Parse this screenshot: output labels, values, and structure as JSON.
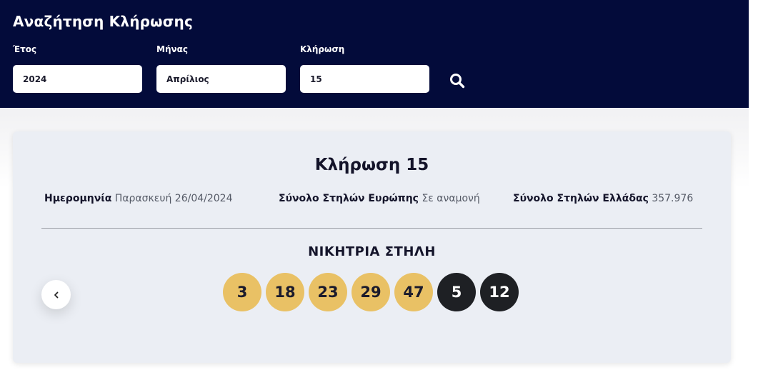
{
  "search": {
    "title": "Αναζήτηση Κλήρωσης",
    "year_label": "Έτος",
    "year_value": "2024",
    "month_label": "Μήνας",
    "month_value": "Απρίλιος",
    "draw_label": "Κλήρωση",
    "draw_value": "15",
    "search_icon": "search-icon"
  },
  "result": {
    "title": "Κλήρωση 15",
    "date_label": "Ημερομηνία",
    "date_value": "Παρασκευή 26/04/2024",
    "europe_label": "Σύνολο Στηλών Ευρώπης",
    "europe_value": "Σε αναμονή",
    "greece_label": "Σύνολο Στηλών Ελλάδας",
    "greece_value": "357.976",
    "winning_title": "ΝΙΚΗΤΡΙΑ ΣΤΗΛΗ",
    "main_numbers": [
      "3",
      "18",
      "23",
      "29",
      "47"
    ],
    "bonus_numbers": [
      "5",
      "12"
    ],
    "prev_icon": "chevron-left-icon"
  },
  "colors": {
    "header_bg": "#030b3a",
    "panel_bg": "#ebeef4",
    "main_ball": "#e9c165",
    "bonus_ball": "#1e2024"
  }
}
